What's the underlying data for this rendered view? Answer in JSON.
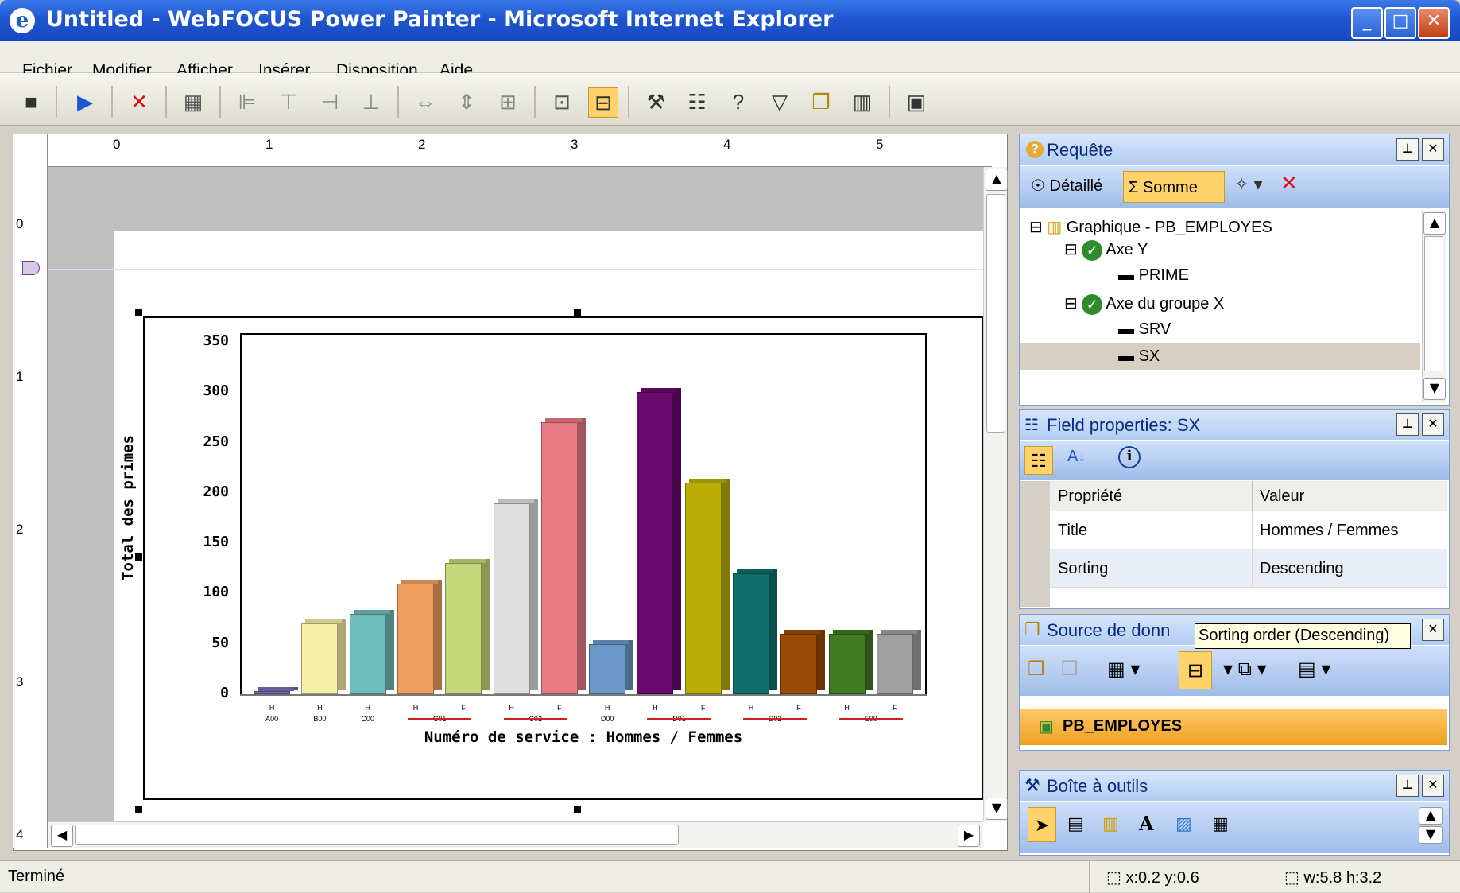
{
  "window": {
    "title": "Untitled - WebFOCUS Power Painter - Microsoft Internet Explorer",
    "min": "_",
    "max": "□",
    "close": "✕"
  },
  "menu": [
    "Fichier",
    "Modifier",
    "Afficher",
    "Insérer",
    "Disposition",
    "Aide"
  ],
  "ruler": {
    "h": [
      "0",
      "1",
      "2",
      "3",
      "4",
      "5"
    ],
    "v": [
      "0",
      "1",
      "2",
      "3",
      "4"
    ]
  },
  "chart_data": {
    "type": "bar",
    "title": "",
    "xlabel": "Numéro de service : Hommes  /  Femmes",
    "ylabel": "Total des primes",
    "ylim": [
      0,
      350
    ],
    "yticks": [
      "350",
      "300",
      "250",
      "200",
      "150",
      "100",
      "50",
      "0"
    ],
    "categories": [
      "A00 H",
      "B00 H",
      "C00 H",
      "C01 H",
      "C01 F",
      "C02 H",
      "C02 F",
      "D00 H",
      "D01 H",
      "D01 F",
      "D02 H",
      "D02 F",
      "E00 H",
      "E00 F"
    ],
    "values": [
      0,
      70,
      80,
      110,
      130,
      190,
      270,
      50,
      300,
      210,
      120,
      60,
      60,
      60
    ],
    "colors": [
      "#7c6bb5",
      "#f6efa6",
      "#6fbdb8",
      "#ee9e5e",
      "#c5d77a",
      "#dedede",
      "#e67b86",
      "#6b97c9",
      "#6a0a6e",
      "#b8ad07",
      "#0d6e6c",
      "#9a4a07",
      "#3f7a21",
      "#a0a0a0"
    ],
    "sex_labels": [
      "H",
      "H",
      "H",
      "H",
      "F",
      "H",
      "F",
      "H",
      "H",
      "F",
      "H",
      "F",
      "H",
      "F"
    ],
    "groups": [
      "A00",
      "B00",
      "C00",
      "C01",
      "C02",
      "D00",
      "D01",
      "D02",
      "E00"
    ]
  },
  "requete": {
    "title": "Requête",
    "tab_detail": "Détaillé",
    "tab_somme": "Somme",
    "tree": [
      "Graphique - PB_EMPLOYES",
      "Axe Y",
      "PRIME",
      "Axe du groupe X",
      "SRV",
      "SX"
    ]
  },
  "fieldprops": {
    "title": "Field properties: SX",
    "col_prop": "Propriété",
    "col_val": "Valeur",
    "rows": [
      [
        "Title",
        "Hommes / Femmes"
      ],
      [
        "Sorting",
        "Descending"
      ]
    ]
  },
  "source": {
    "title": "Source de donn",
    "tooltip": "Sorting order (Descending)",
    "item": "PB_EMPLOYES"
  },
  "toolbox": {
    "title": "Boîte à outils"
  },
  "status": {
    "text": "Terminé",
    "pos": "x:0.2 y:0.6",
    "size": "w:5.8 h:3.2"
  }
}
